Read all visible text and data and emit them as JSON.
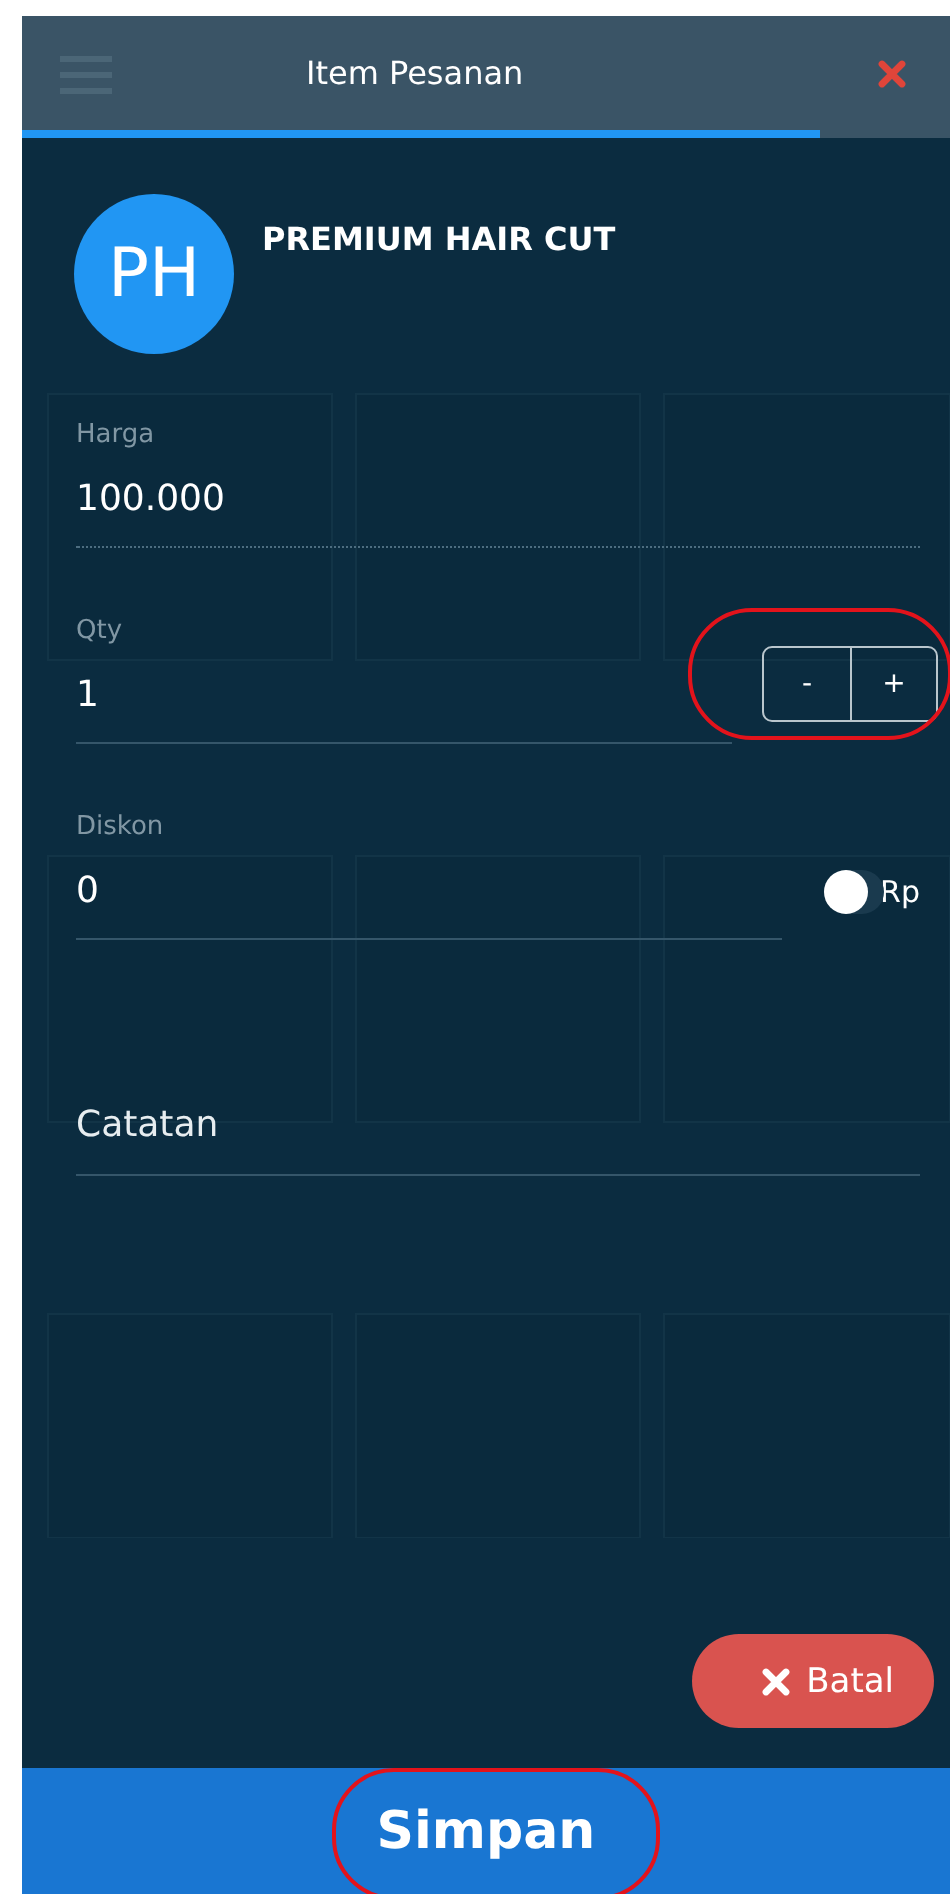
{
  "header": {
    "title": "Item Pesanan",
    "progress": {
      "level": 0.86
    }
  },
  "item": {
    "initials": "PH",
    "name": "PREMIUM HAIR CUT"
  },
  "fields": [
    {
      "kind": "price",
      "label": "Harga",
      "value": "100.000"
    },
    {
      "kind": "stepper",
      "label": "Qty",
      "value": "1",
      "buttons": [
        "-",
        "+"
      ]
    },
    {
      "kind": "toggle",
      "label": "Diskon",
      "value": "0",
      "unit": "Rp",
      "on": false
    },
    {
      "kind": "note",
      "placeholder": "Catatan"
    }
  ],
  "cancel_button": {
    "label": "Batal"
  },
  "save_button": {
    "label": "Simpan"
  }
}
